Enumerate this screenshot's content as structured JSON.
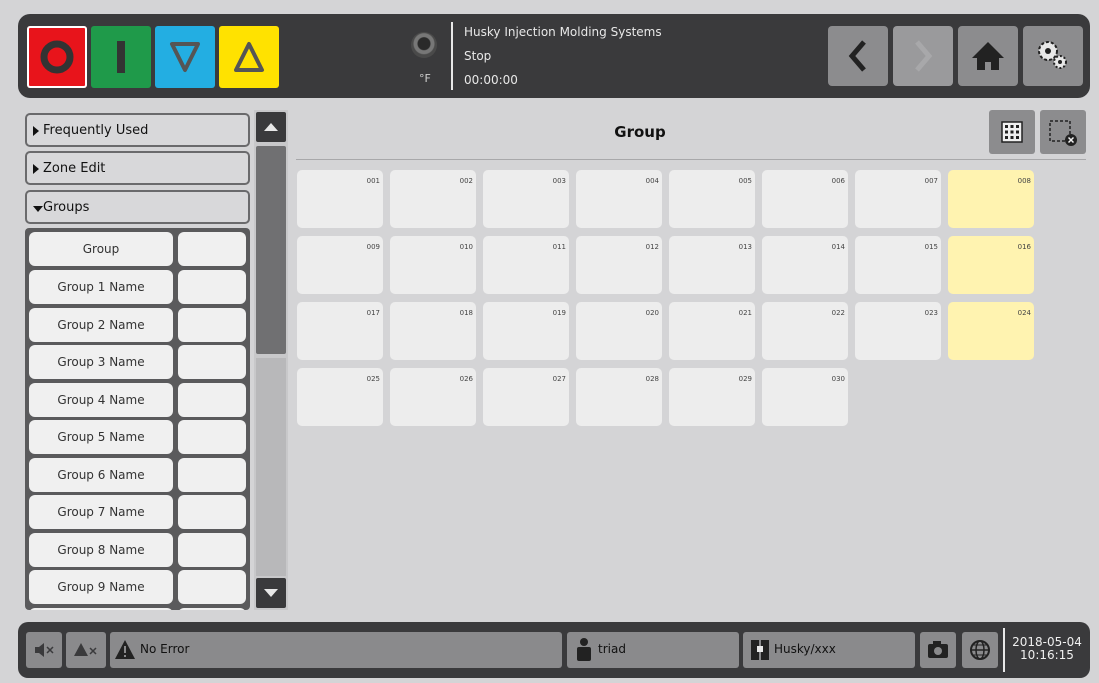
{
  "header": {
    "temp_unit": "°F",
    "title": "Husky Injection Molding Systems",
    "status": "Stop",
    "timer": "00:00:00"
  },
  "mode_buttons": {
    "stop_color": "#e8141b",
    "on_color": "#1f9a4a",
    "down_color": "#23aee2",
    "up_color": "#ffe200"
  },
  "sidebar": {
    "sections": [
      "Frequently Used",
      "Zone Edit",
      "Groups"
    ],
    "group_header": "Group",
    "groups": [
      "Group 1 Name",
      "Group 2 Name",
      "Group 3 Name",
      "Group 4 Name",
      "Group 5 Name",
      "Group 6 Name",
      "Group 7 Name",
      "Group 8 Name",
      "Group 9 Name"
    ]
  },
  "main": {
    "title": "Group",
    "tiles": [
      "001",
      "002",
      "003",
      "004",
      "005",
      "006",
      "007",
      "008",
      "009",
      "010",
      "011",
      "012",
      "013",
      "014",
      "015",
      "016",
      "017",
      "018",
      "019",
      "020",
      "021",
      "022",
      "023",
      "024",
      "025",
      "026",
      "027",
      "028",
      "029",
      "030"
    ],
    "highlighted": [
      "008",
      "016",
      "024"
    ]
  },
  "footer": {
    "status": "No Error",
    "user": "triad",
    "mold": "Husky/xxx",
    "date": "2018-05-04",
    "time": "10:16:15"
  }
}
